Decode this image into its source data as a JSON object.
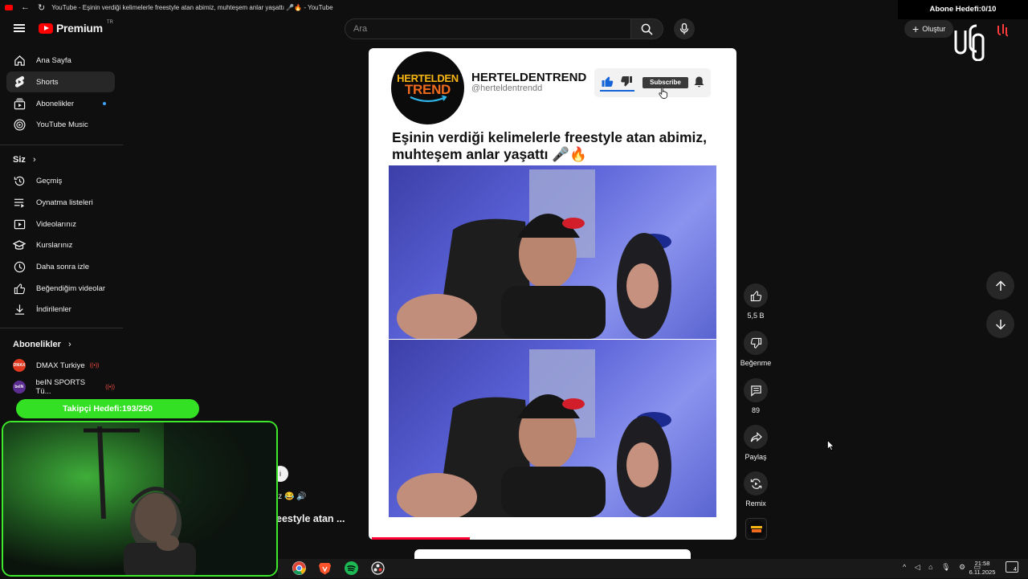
{
  "window": {
    "title": "YouTube - Eşinin verdiği kelimelerle freestyle atan abimiz, muhteşem anlar yaşattı 🎤🔥 - YouTube"
  },
  "header": {
    "logo_text": "Premium",
    "region": "TR",
    "search_placeholder": "Ara",
    "create_label": "Oluştur"
  },
  "sidebar": {
    "main": [
      {
        "label": "Ana Sayfa",
        "icon": "home-icon"
      },
      {
        "label": "Shorts",
        "icon": "shorts-icon",
        "active": true
      },
      {
        "label": "Abonelikler",
        "icon": "subscriptions-icon"
      },
      {
        "label": "YouTube Music",
        "icon": "youtube-music-icon"
      }
    ],
    "you_heading": "Siz",
    "you": [
      {
        "label": "Geçmiş",
        "icon": "history-icon"
      },
      {
        "label": "Oynatma listeleri",
        "icon": "playlists-icon"
      },
      {
        "label": "Videolarınız",
        "icon": "your-videos-icon"
      },
      {
        "label": "Kurslarınız",
        "icon": "courses-icon"
      },
      {
        "label": "Daha sonra izle",
        "icon": "watch-later-icon"
      },
      {
        "label": "Beğendiğim videolar",
        "icon": "liked-videos-icon"
      },
      {
        "label": "İndirilenler",
        "icon": "downloads-icon"
      }
    ],
    "subs_heading": "Abonelikler",
    "subscriptions": [
      {
        "label": "DMAX Turkiye",
        "avatar_text": "DMAX",
        "color": "#e0391f"
      },
      {
        "label": "beIN SPORTS Tü...",
        "avatar_text": "beIN",
        "color": "#5c2d91"
      }
    ]
  },
  "short": {
    "channel_logo_top": "HERTELDEN",
    "channel_logo_bottom": "TREND",
    "channel_name": "HERTELDENTREND",
    "channel_handle": "@herteldentrendd",
    "subscribe_label": "Subscribe",
    "title": "Eşinin verdiği kelimelerle freestyle atan abimiz, muhteşem anlar yaşattı 🎤🔥",
    "progress_fraction": 0.27
  },
  "actions": {
    "like_count": "5,5 B",
    "dislike_label": "Beğenme",
    "comment_count": "89",
    "share_label": "Paylaş",
    "remix_label": "Remix"
  },
  "overlay": {
    "follower_goal": "Takipçi Hedefi:193/250",
    "subscriber_goal": "Abone Hedefi:0/10"
  },
  "peek": {
    "line1": "iz 😂 🔊",
    "line2": "eestyle atan ..."
  },
  "taskbar": {
    "time": "21:58",
    "date": "6.11.2025",
    "notification_count": "4"
  }
}
